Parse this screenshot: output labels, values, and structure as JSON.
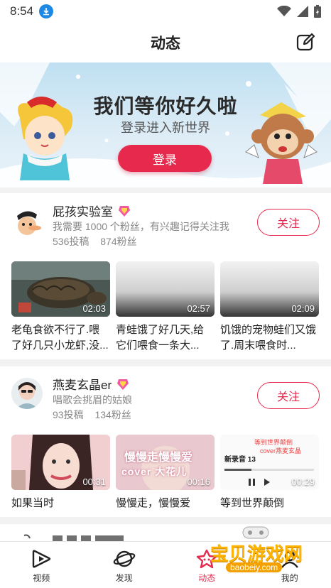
{
  "status": {
    "time": "8:54"
  },
  "header": {
    "title": "动态"
  },
  "banner": {
    "title": "我们等你好久啦",
    "subtitle": "登录进入新世界",
    "login_label": "登录"
  },
  "cards": [
    {
      "name": "屁孩实验室",
      "bio": "我需要 1000 个粉丝，有兴趣记得关注我",
      "posts": "536投稿",
      "fans": "874粉丝",
      "follow": "关注",
      "videos": [
        {
          "title": "老龟食欲不行了.喂了好几只小龙虾,没...",
          "duration": "02:03"
        },
        {
          "title": "青蛙饿了好几天,给它们喂食一条大...",
          "duration": "02:57"
        },
        {
          "title": "饥饿的宠物蛙们又饿了.周末喂食时...",
          "duration": "02:09"
        }
      ]
    },
    {
      "name": "燕麦玄晶er",
      "bio": "唱歌会挑眉的姑娘",
      "posts": "93投稿",
      "fans": "134粉丝",
      "follow": "关注",
      "videos": [
        {
          "title": "如果当时",
          "duration": "00:31"
        },
        {
          "title": "慢慢走，慢慢爱",
          "duration": "00:16",
          "overlay": "慢慢走慢慢爱",
          "overlay2": "cover 大花儿"
        },
        {
          "title": "等到世界颠倒",
          "duration": "00:29",
          "overlay": "等到世界颠倒",
          "overlay2": "cover燕麦玄晶",
          "lyric_title": "新录音 13"
        }
      ]
    }
  ],
  "tabs": [
    {
      "label": "视频",
      "icon": "video-icon"
    },
    {
      "label": "发现",
      "icon": "planet-icon"
    },
    {
      "label": "动态",
      "icon": "star-icon",
      "active": true
    },
    {
      "label": "我的",
      "icon": "user-icon"
    }
  ],
  "watermark": {
    "text": "宝贝游戏网",
    "url": "baobeiy.com"
  },
  "colors": {
    "accent": "#e6294d",
    "banner_bg": "#cfe6f4"
  }
}
